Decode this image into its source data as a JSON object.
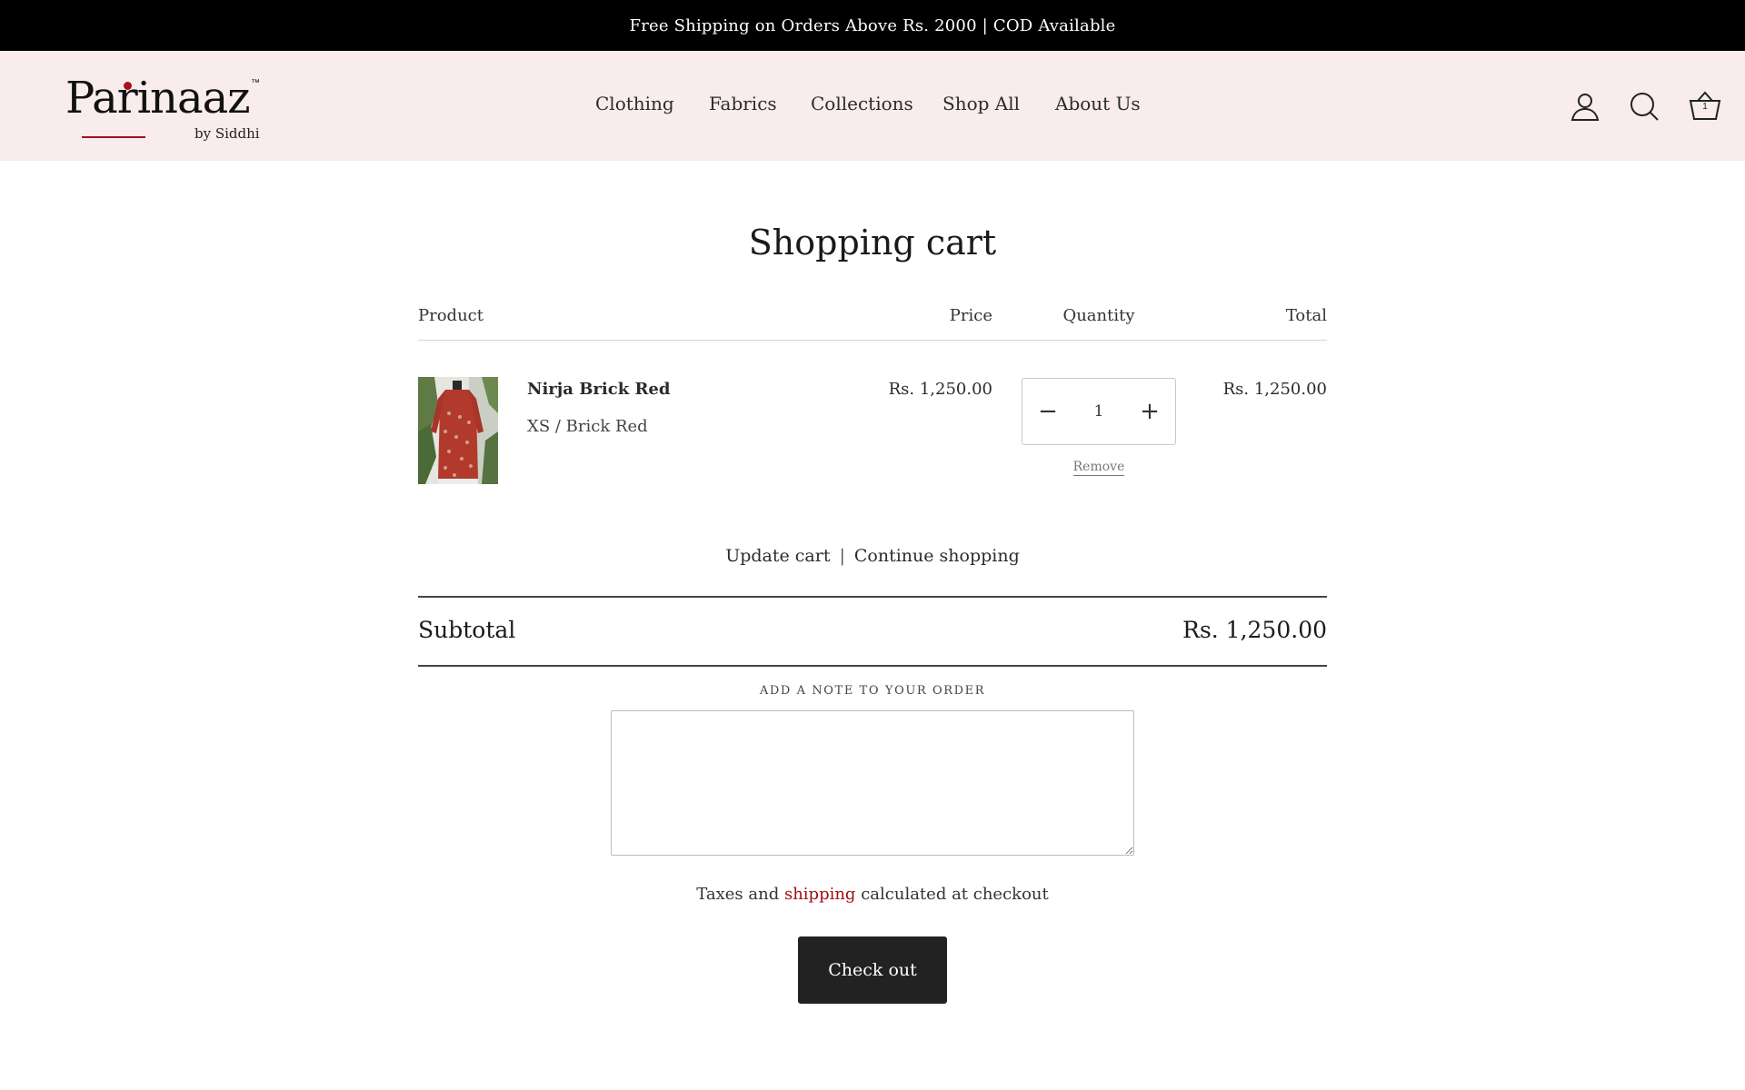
{
  "announcement": "Free Shipping on Orders Above Rs. 2000 | COD Available",
  "brand": {
    "name": "Parinaaz",
    "trademark": "™",
    "tagline": "by Siddhi",
    "accent": "#a8101a"
  },
  "nav": [
    {
      "label": "Clothing"
    },
    {
      "label": "Fabrics"
    },
    {
      "label": "Collections"
    },
    {
      "label": "Shop All"
    },
    {
      "label": "About Us"
    }
  ],
  "header_icons": {
    "account": "user-icon",
    "search": "search-icon",
    "cart": "basket-icon",
    "cart_count": "1"
  },
  "cart": {
    "title": "Shopping cart",
    "columns": {
      "product": "Product",
      "price": "Price",
      "quantity": "Quantity",
      "total": "Total"
    },
    "items": [
      {
        "name": "Nirja Brick Red",
        "variant": "XS / Brick Red",
        "price": "Rs. 1,250.00",
        "quantity": "1",
        "total": "Rs. 1,250.00",
        "remove_label": "Remove",
        "decrease_symbol": "−",
        "increase_symbol": "+"
      }
    ],
    "update_label": "Update cart",
    "separator": "|",
    "continue_label": "Continue shopping",
    "subtotal_label": "Subtotal",
    "subtotal_value": "Rs. 1,250.00",
    "note_label": "ADD A NOTE TO YOUR ORDER",
    "note_value": "",
    "tax_prefix": "Taxes and",
    "tax_link": "shipping",
    "tax_suffix": "calculated at checkout",
    "checkout_label": "Check out"
  },
  "colors": {
    "announcement_bg": "#000000",
    "header_bg": "#f8ecec",
    "link_accent": "#a10e16",
    "button_bg": "#222222"
  }
}
